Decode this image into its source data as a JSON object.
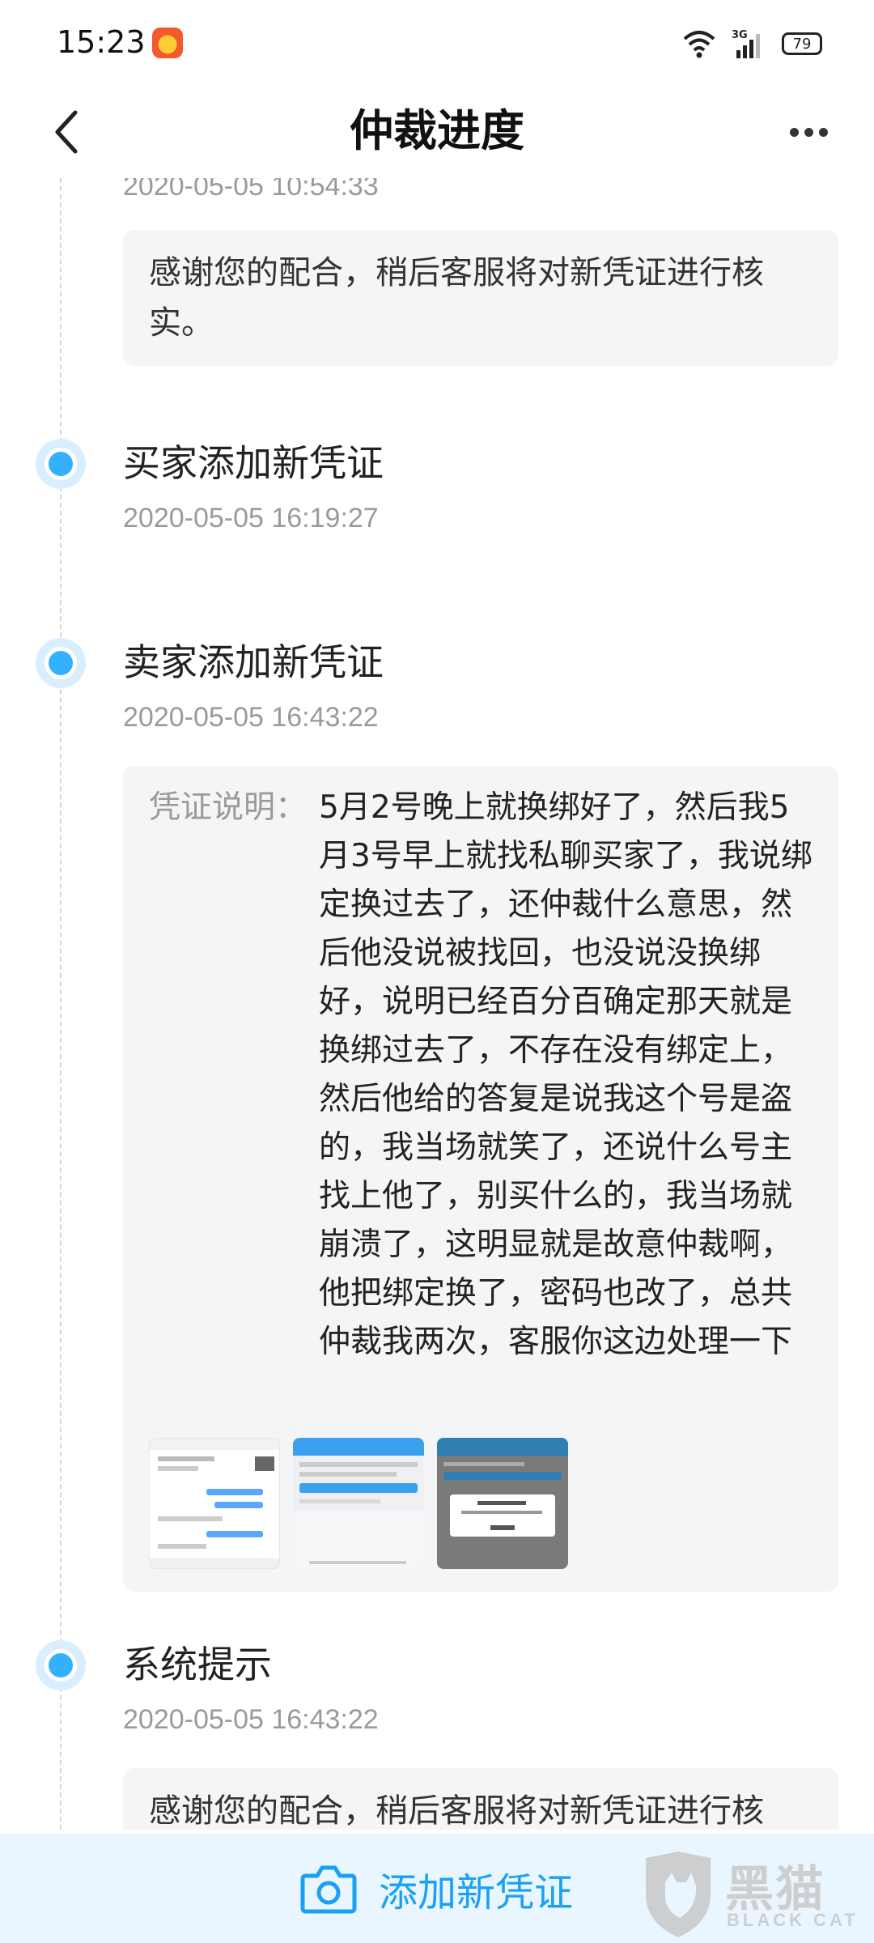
{
  "status_bar": {
    "time": "15:23",
    "network": "3G",
    "battery": "79",
    "icons": [
      "app-notification-icon",
      "wifi-icon",
      "signal-icon",
      "battery-icon"
    ]
  },
  "header": {
    "title": "仲裁进度",
    "back_icon": "chevron-left-icon",
    "more_icon": "more-horizontal-icon"
  },
  "timeline": {
    "partial_top": {
      "time": "2020-05-05 10:54:33",
      "message": "感谢您的配合，稍后客服将对新凭证进行核实。"
    },
    "events": [
      {
        "title": "买家添加新凭证",
        "time": "2020-05-05 16:19:27"
      },
      {
        "title": "卖家添加新凭证",
        "time": "2020-05-05 16:43:22",
        "evidence_label": "凭证说明：",
        "evidence_text": "5月2号晚上就换绑好了，然后我5月3号早上就找私聊买家了，我说绑定换过去了，还仲裁什么意思，然后他没说被找回，也没说没换绑好，说明已经百分百确定那天就是换绑过去了，不存在没有绑定上，然后他给的答复是说我这个号是盗的，我当场就笑了，还说什么号主找上他了，别买什么的，我当场就崩溃了，这明显就是故意仲裁啊，他把绑定换了，密码也改了，总共仲裁我两次，客服你这边处理一下",
        "attachments": [
          "chat-screenshot",
          "phone-binding-screenshot",
          "dialog-screenshot"
        ]
      },
      {
        "title": "系统提示",
        "time": "2020-05-05 16:43:22",
        "message": "感谢您的配合，稍后客服将对新凭证进行核实。"
      }
    ]
  },
  "bottom_bar": {
    "add_label": "添加新凭证",
    "add_icon": "camera-icon"
  },
  "watermark": {
    "text": "黑猫",
    "sub": "BLACK CAT"
  },
  "colors": {
    "accent": "#1aa0f5",
    "dot": "#33b1ff",
    "card_bg": "#f4f5f7",
    "bottom_bg": "#eaf6ff",
    "time_text": "#9a9a9a"
  }
}
